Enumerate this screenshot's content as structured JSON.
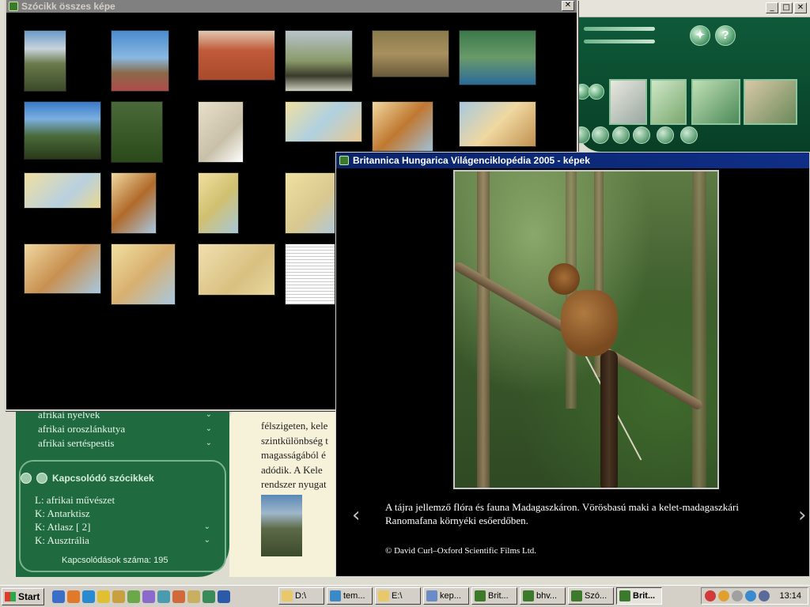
{
  "background_app": {
    "window_buttons": [
      "_",
      "□",
      "✕"
    ],
    "list_items": [
      "afrikai nyelvek",
      "afrikai oroszlánkutya",
      "afrikai sertéspestis"
    ],
    "related_title": "Kapcsolódó szócikkek",
    "related_items": [
      "L: afrikai művészet",
      "K: Antarktisz",
      "K: Atlasz [ 2]",
      "K: Ausztrália"
    ],
    "related_count": "Kapcsolódások száma:  195",
    "article_lines": [
      "félszigeten, kele",
      "szintkülönbség t",
      "magasságából é",
      "adódik. A Kele",
      "rendszer nyugat"
    ]
  },
  "grid_window": {
    "title": "Szócikk összes képe",
    "close_label": "✕"
  },
  "viewer_window": {
    "title": "Britannica Hungarica Világenciklopédia 2005 - képek",
    "caption": "A tájra jellemző flóra és fauna Madagaszkáron. Vörösbasú maki a kelet-madagaszkári Ranomafana környéki esőerdőben.",
    "credit": "© David Curl–Oxford Scientific Films Ltd.",
    "prev_arrow": "‹",
    "next_arrow": "›"
  },
  "taskbar": {
    "start_label": "Start",
    "tasks": [
      "D:\\",
      "tem...",
      "E:\\",
      "kep...",
      "Brit...",
      "bhv...",
      "Szó...",
      "Brit..."
    ],
    "clock": "13:14"
  }
}
